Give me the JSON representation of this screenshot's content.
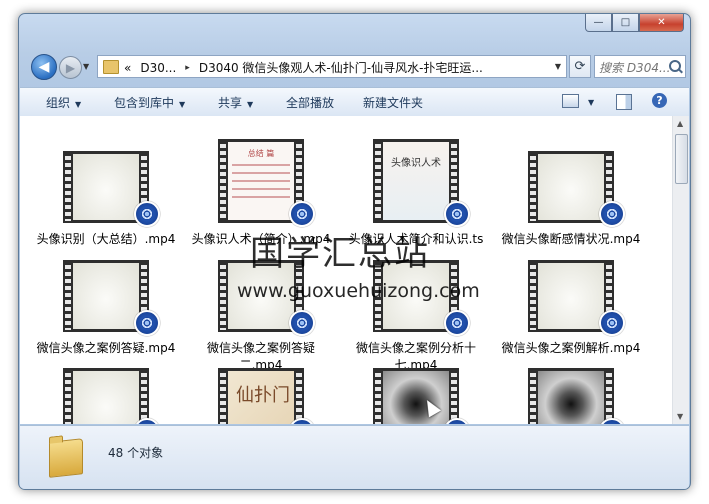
{
  "window": {
    "min": "—",
    "max": "□",
    "close": "✕"
  },
  "address": {
    "crumb1": "«",
    "crumb2": "D30...",
    "sep": "▸",
    "crumb3": "D3040  微信头像观人术-仙扑门-仙寻风水-扑宅旺运..."
  },
  "search": {
    "placeholder": "搜索 D304..."
  },
  "toolbar": {
    "organize": "组织",
    "include_library": "包含到库中",
    "share": "共享",
    "play_all": "全部播放",
    "new_folder": "新建文件夹"
  },
  "files": [
    {
      "name": "头像识别（大总结）.mp4"
    },
    {
      "name": "头像识人术（简介）.mp4",
      "thumb_text": "总结 篇"
    },
    {
      "name": "头像识人术简介和认识.ts",
      "thumb_text": "头像识人术"
    },
    {
      "name": "微信头像断感情状况.mp4"
    },
    {
      "name": "微信头像之案例答疑.mp4"
    },
    {
      "name": "微信头像之案例答疑二.mp4"
    },
    {
      "name": "微信头像之案例分析十七.mp4"
    },
    {
      "name": "微信头像之案例解析.mp4"
    },
    {
      "name": ""
    },
    {
      "name": "",
      "thumb_text": "仙扑门"
    },
    {
      "name": ""
    },
    {
      "name": ""
    }
  ],
  "watermark": {
    "line1": "国学汇总站",
    "line2": "www.guoxuehuizong.com"
  },
  "status": {
    "count": "48 个对象"
  }
}
